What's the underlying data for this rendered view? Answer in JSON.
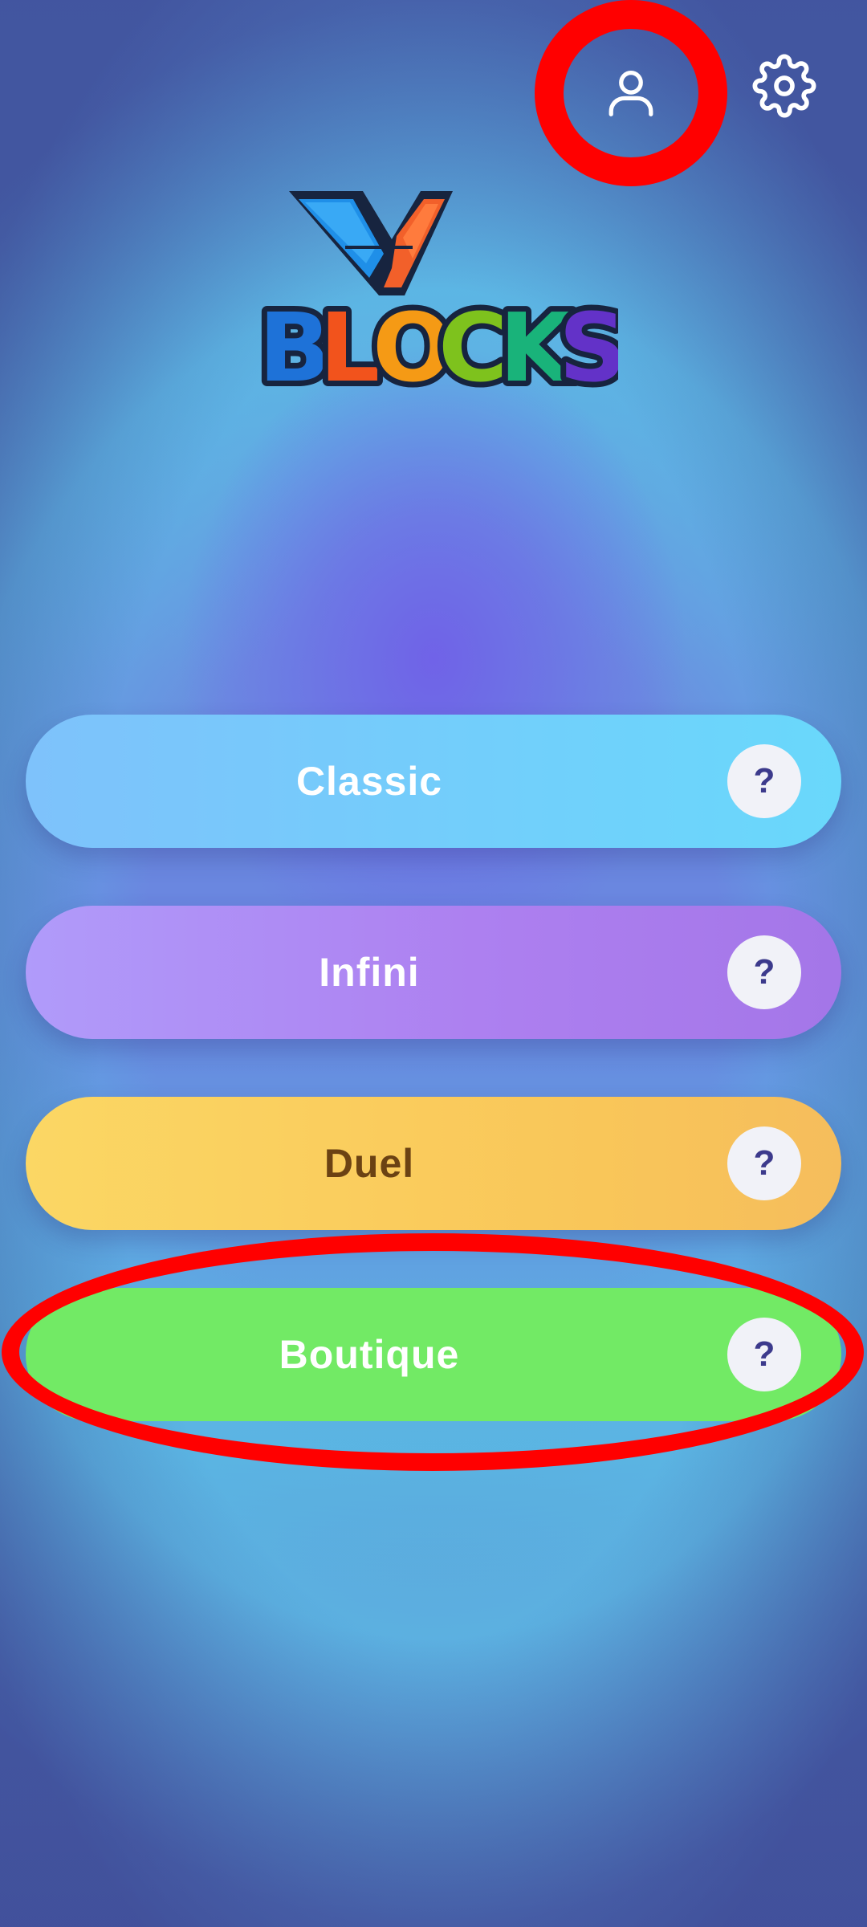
{
  "header": {
    "profile_icon": "user-icon",
    "settings_icon": "gear-icon"
  },
  "logo": {
    "text_line1": "V",
    "text_line2": "BLOCKS"
  },
  "modes": [
    {
      "label": "Classic",
      "help": "?"
    },
    {
      "label": "Infini",
      "help": "?"
    },
    {
      "label": "Duel",
      "help": "?"
    },
    {
      "label": "Boutique",
      "help": "?"
    }
  ],
  "highlights": {
    "color": "#ff0000"
  },
  "colors": {
    "classic": "#6fd0fb",
    "infini": "#ad84f2",
    "duel": "#f9ca5c",
    "boutique": "#72ea65",
    "help_text": "#3c3a8c"
  }
}
